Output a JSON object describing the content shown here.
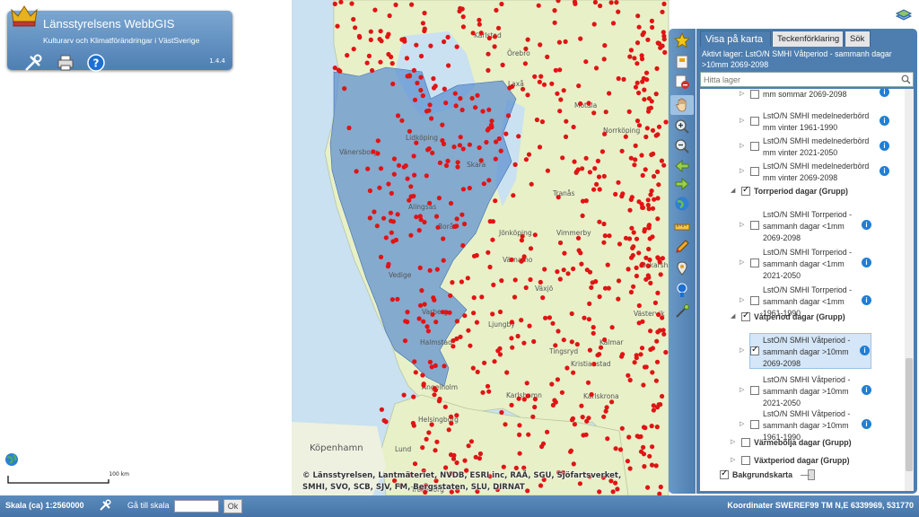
{
  "app": {
    "title": "Länsstyrelsens WebbGIS",
    "subtitle": "Kulturarv och Klimatförändringar i VästSverige",
    "version": "1.4.4"
  },
  "map": {
    "copyright_line1": "© Länsstyrelsen, Lantmäteriet, NVDB, ESRI inc, RAÄ, SGU, Sjöfartsverket,",
    "copyright_line2": "SMHI, SVO, SCB, SJV, FM, Bergsstaten, SLU, DIRNAT",
    "scale_label": "100 km",
    "places": [
      "Karlstad",
      "Örebro",
      "Vänersborg",
      "Lidköping",
      "Skara",
      "Laxå",
      "Norrköping",
      "Alingsås",
      "Borås",
      "Jönköping",
      "Tranås",
      "Vimmerby",
      "Värnamo",
      "Växjö",
      "Varberg",
      "Halmstad",
      "Ljungby",
      "Tingsryd",
      "Kalmar",
      "Oskarshamn",
      "Ängelholm",
      "Kristianstad",
      "Karlshamn",
      "Karlskrona",
      "Helsingborg",
      "Lund",
      "Köpenhamn",
      "Trelleborg",
      "Motala",
      "Vedige",
      "Västervik"
    ],
    "colors": {
      "land": "#e8f0c8",
      "sea": "#c9e1f0",
      "overlay": "#5d8fd0",
      "points": "#e01414"
    }
  },
  "panel": {
    "tabs": [
      "Visa på karta",
      "Teckenförklaring",
      "Sök"
    ],
    "active_layer": "Aktivt lager:  LstO/N SMHI Våtperiod - sammanh dagar >10mm 2069-2098",
    "search_placeholder": "Hitta lager",
    "tree": [
      {
        "l1": "mm sommar 2069-2098",
        "checked": false,
        "group": false
      },
      {
        "l1": "LstO/N SMHI medelnederbörd",
        "l2": "mm vinter 1961-1990",
        "checked": false,
        "group": false
      },
      {
        "l1": "LstO/N SMHI medelnederbörd",
        "l2": "mm vinter 2021-2050",
        "checked": false,
        "group": false
      },
      {
        "l1": "LstO/N SMHI medelnederbörd",
        "l2": "mm vinter 2069-2098",
        "checked": false,
        "group": false
      },
      {
        "l1": "Torrperiod dagar (Grupp)",
        "checked": true,
        "group": true
      },
      {
        "l1": "LstO/N SMHI Torrperiod -",
        "l2": "sammanh dagar <1mm",
        "l3": "2069-2098",
        "checked": false,
        "group": false
      },
      {
        "l1": "LstO/N SMHI Torrperiod -",
        "l2": "sammanh dagar <1mm",
        "l3": "2021-2050",
        "checked": false,
        "group": false
      },
      {
        "l1": "LstO/N SMHI Torrperiod -",
        "l2": "sammanh dagar <1mm",
        "l3": "1961-1990",
        "checked": false,
        "group": false
      },
      {
        "l1": "Våtperiod dagar (Grupp)",
        "checked": true,
        "group": true
      },
      {
        "l1": "LstO/N SMHI Våtperiod -",
        "l2": "sammanh dagar >10mm",
        "l3": "2069-2098",
        "checked": true,
        "group": false
      },
      {
        "l1": "LstO/N SMHI Våtperiod -",
        "l2": "sammanh dagar >10mm",
        "l3": "2021-2050",
        "checked": false,
        "group": false
      },
      {
        "l1": "LstO/N SMHI Våtperiod -",
        "l2": "sammanh dagar >10mm",
        "l3": "1961-1990",
        "checked": false,
        "group": false
      },
      {
        "l1": "Värmebölja dagar (Grupp)",
        "checked": false,
        "group": true
      },
      {
        "l1": "Växtperiod dagar (Grupp)",
        "checked": false,
        "group": true
      },
      {
        "l1": "Bakgrundskarta",
        "checked": true,
        "group": true
      }
    ]
  },
  "statusbar": {
    "scale": "Skala (ca) 1:2560000",
    "goto_label": "Gå till skala",
    "ok_label": "Ok",
    "coordinates": "Koordinater SWEREF99 TM N,E 6339969, 531770"
  }
}
